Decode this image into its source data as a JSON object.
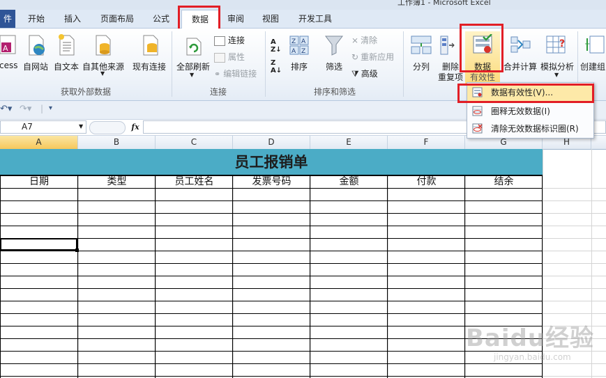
{
  "window": {
    "title": "工作簿1 - Microsoft Excel"
  },
  "tabs": {
    "file": "件",
    "items": [
      {
        "label": "开始",
        "active": false
      },
      {
        "label": "插入",
        "active": false
      },
      {
        "label": "页面布局",
        "active": false
      },
      {
        "label": "公式",
        "active": false
      },
      {
        "label": "数据",
        "active": true
      },
      {
        "label": "审阅",
        "active": false
      },
      {
        "label": "视图",
        "active": false
      },
      {
        "label": "开发工具",
        "active": false
      }
    ]
  },
  "ribbon": {
    "get_external": {
      "group_label": "获取外部数据",
      "buttons": [
        "ccess",
        "自网站",
        "自文本",
        "自其他来源",
        "现有连接"
      ]
    },
    "connections": {
      "group_label": "连接",
      "refresh_all": "全部刷新",
      "small": [
        {
          "label": "连接",
          "disabled": false
        },
        {
          "label": "属性",
          "disabled": true
        },
        {
          "label": "编辑链接",
          "disabled": true
        }
      ]
    },
    "sort_filter": {
      "group_label": "排序和筛选",
      "sort": "排序",
      "filter": "筛选",
      "small": [
        {
          "label": "清除",
          "disabled": true
        },
        {
          "label": "重新应用",
          "disabled": true
        },
        {
          "label": "高级",
          "disabled": false
        }
      ]
    },
    "data_tools": {
      "split": "分列",
      "remove_dup_line1": "删除",
      "remove_dup_line2": "重复项",
      "validation_line1": "数据",
      "validation_line2": "有效性",
      "consolidate": "合并计算",
      "whatif": "模拟分析",
      "create_group": "创建组"
    }
  },
  "formula_bar": {
    "name_box": "A7",
    "fx": "fx",
    "value": ""
  },
  "columns": [
    "A",
    "B",
    "C",
    "D",
    "E",
    "F",
    "G",
    "H"
  ],
  "selected_column": "A",
  "sheet": {
    "banner": "员工报销单",
    "headers": [
      "日期",
      "类型",
      "员工姓名",
      "发票号码",
      "金额",
      "付款",
      "结余"
    ],
    "selected_cell": "A7"
  },
  "dropdown": {
    "items": [
      {
        "label": "数据有效性(V)...",
        "icon": "data-validation-icon",
        "highlighted": true
      },
      {
        "label": "圈释无效数据(I)",
        "icon": "circle-invalid-icon",
        "highlighted": false
      },
      {
        "label": "清除无效数据标识圈(R)",
        "icon": "clear-circles-icon",
        "highlighted": false
      }
    ]
  },
  "watermark": {
    "brand": "Baidu经验",
    "url": "jingyan.baidu.com"
  },
  "colors": {
    "accent": "#e21e26",
    "banner": "#4bacc6",
    "menu_highlight": "#fde9a8"
  }
}
